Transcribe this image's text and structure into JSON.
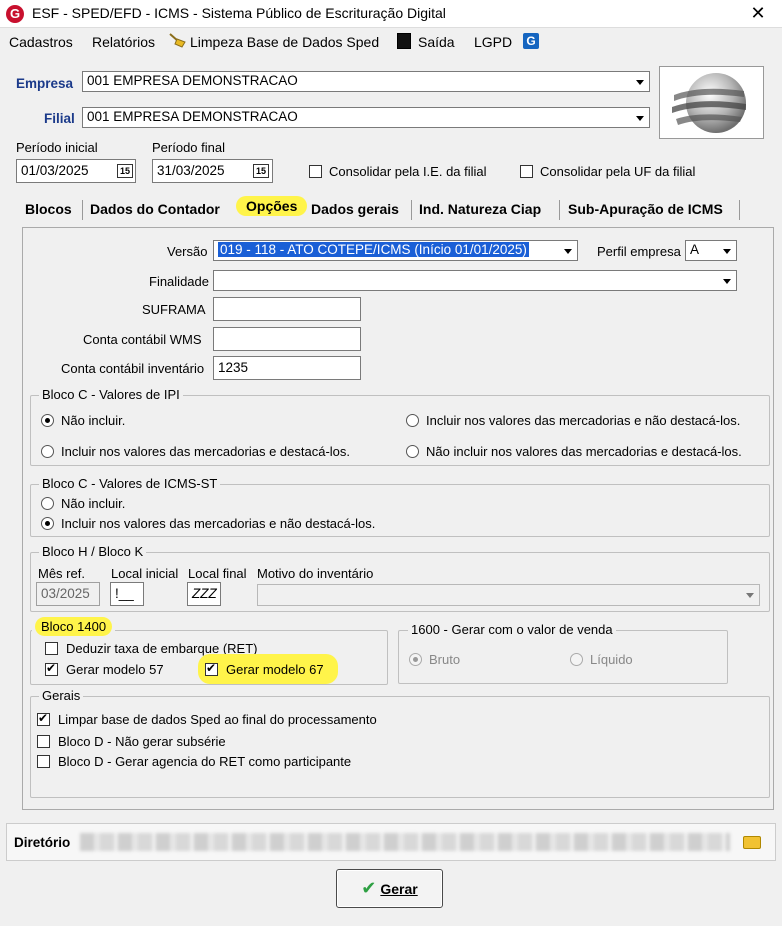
{
  "window": {
    "title": "ESF - SPED/EFD - ICMS - Sistema Público de Escrituração Digital",
    "logo": "G"
  },
  "menu": {
    "cadastros": "Cadastros",
    "relatorios": "Relatórios",
    "limpeza": "Limpeza Base de Dados Sped",
    "saida": "Saída",
    "lgpd": "LGPD"
  },
  "header": {
    "empresa_label": "Empresa",
    "empresa_value": "001 EMPRESA DEMONSTRACAO",
    "filial_label": "Filial",
    "filial_value": "001 EMPRESA DEMONSTRACAO",
    "periodo_inicial_label": "Período inicial",
    "periodo_inicial_value": "01/03/2025",
    "periodo_final_label": "Período final",
    "periodo_final_value": "31/03/2025",
    "calendar_icon_text": "15",
    "consolidar_ie": "Consolidar pela I.E. da filial",
    "consolidar_uf": "Consolidar pela UF da filial"
  },
  "tabs": [
    "Blocos",
    "Dados do Contador",
    "Opções",
    "Dados gerais",
    "Ind. Natureza Ciap",
    "Sub-Apuração de ICMS"
  ],
  "opcoes": {
    "versao_label": "Versão",
    "versao_value": "019 - 118 - ATO COTEPE/ICMS (Início 01/01/2025)",
    "perfil_label": "Perfil empresa",
    "perfil_value": "A",
    "finalidade_label": "Finalidade",
    "finalidade_value": "",
    "suframa_label": "SUFRAMA",
    "suframa_value": "",
    "conta_wms_label": "Conta contábil WMS",
    "conta_wms_value": "",
    "conta_inventario_label": "Conta contábil inventário",
    "conta_inventario_value": "1235"
  },
  "bloco_c_ipi": {
    "title": "Bloco C - Valores de IPI",
    "opt1": "Não incluir.",
    "opt2": "Incluir nos valores das mercadorias e não destacá-los.",
    "opt3": "Incluir nos valores das mercadorias e destacá-los.",
    "opt4": "Não incluir nos valores das mercadorias e destacá-los."
  },
  "bloco_c_icmsst": {
    "title": "Bloco C - Valores de ICMS-ST",
    "opt1": "Não incluir.",
    "opt2": "Incluir nos valores das mercadorias e não destacá-los."
  },
  "bloco_hk": {
    "title": "Bloco H / Bloco K",
    "mes_ref_label": "Mês ref.",
    "mes_ref_value": "03/2025",
    "local_inicial_label": "Local inicial",
    "local_inicial_value": "!__",
    "local_final_label": "Local final",
    "local_final_value": "ZZZ",
    "motivo_label": "Motivo do inventário",
    "motivo_value": ""
  },
  "bloco_1400": {
    "title": "Bloco 1400",
    "deduzir": "Deduzir taxa de embarque (RET)",
    "modelo57": "Gerar modelo 57",
    "modelo67": "Gerar modelo 67"
  },
  "bloco_1600": {
    "title": "1600 - Gerar com o valor de venda",
    "bruto": "Bruto",
    "liquido": "Líquido"
  },
  "gerais": {
    "title": "Gerais",
    "limpar": "Limpar base de dados Sped ao final do processamento",
    "bloco_d_subserie": "Bloco D - Não gerar subsérie",
    "bloco_d_agencia": "Bloco D - Gerar agencia do RET como participante"
  },
  "footer": {
    "diretorio_label": "Diretório",
    "gerar_label": "Gerar"
  },
  "colors": {
    "highlight": "#fff44a",
    "label_blue": "#1b3a8a",
    "selection": "#1a5fd6",
    "brand_red": "#c8102e"
  }
}
